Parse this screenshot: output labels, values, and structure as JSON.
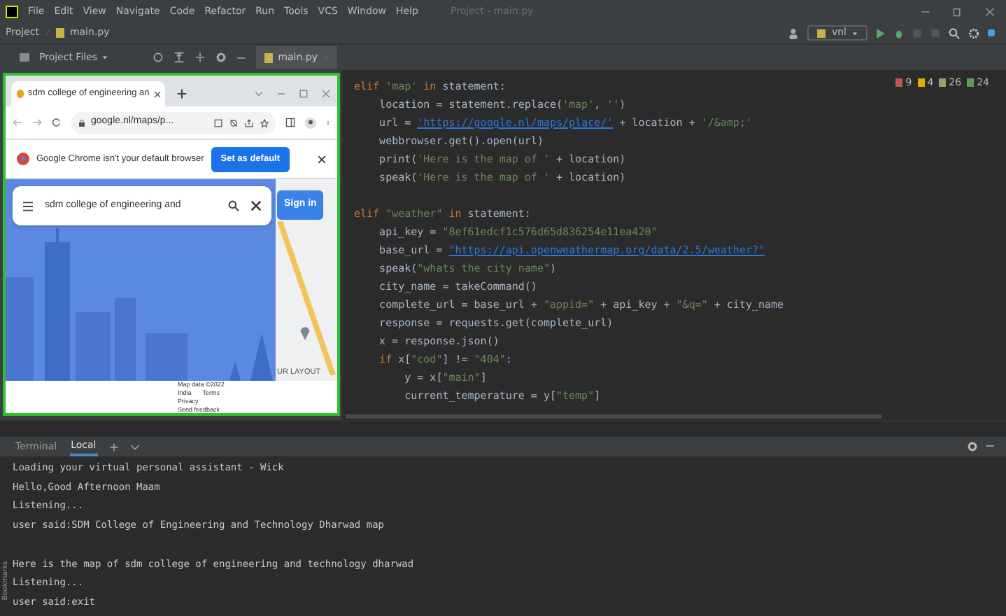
{
  "menu_bar": {
    "items": [
      "File",
      "Edit",
      "View",
      "Navigate",
      "Code",
      "Refactor",
      "Run",
      "Tools",
      "VCS",
      "Window",
      "Help"
    ],
    "title": "Project - main.py"
  },
  "breadcrumb": [
    "Project",
    "main.py"
  ],
  "project_panel": {
    "title": "Project Files"
  },
  "editor_tab": {
    "label": "main.py"
  },
  "run_config": "vnl",
  "inspections": [
    {
      "kind": "error",
      "count": "9"
    },
    {
      "kind": "warning",
      "count": "4"
    },
    {
      "kind": "weak",
      "count": "26"
    },
    {
      "kind": "typo",
      "count": "24"
    }
  ],
  "code_lines": [
    {
      "kind": "code",
      "tokens": [
        {
          "t": "elif ",
          "kind": "kw"
        },
        {
          "t": "'map'",
          "kind": "str"
        },
        {
          "t": " in ",
          "kind": "kw"
        },
        {
          "t": "statement:",
          "kind": "plain"
        }
      ]
    },
    {
      "kind": "code",
      "tokens": [
        {
          "t": "    location = statement.replace(",
          "kind": "plain"
        },
        {
          "t": "'map'",
          "kind": "str"
        },
        {
          "t": ", ",
          "kind": "plain"
        },
        {
          "t": "''",
          "kind": "str"
        },
        {
          "t": ")",
          "kind": "plain"
        }
      ]
    },
    {
      "kind": "code",
      "tokens": [
        {
          "t": "    url = ",
          "kind": "plain"
        },
        {
          "t": "'https://google.nl/maps/place/'",
          "kind": "link"
        },
        {
          "t": " + location + ",
          "kind": "plain"
        },
        {
          "t": "'/&amp;'",
          "kind": "str"
        }
      ]
    },
    {
      "kind": "code",
      "tokens": [
        {
          "t": "    webbrowser.get().open(url)",
          "kind": "plain"
        }
      ]
    },
    {
      "kind": "code",
      "tokens": [
        {
          "t": "    print(",
          "kind": "plain"
        },
        {
          "t": "'Here is the map of '",
          "kind": "str"
        },
        {
          "t": " + location)",
          "kind": "plain"
        }
      ]
    },
    {
      "kind": "code",
      "tokens": [
        {
          "t": "    speak(",
          "kind": "plain"
        },
        {
          "t": "'Here is the map of '",
          "kind": "str"
        },
        {
          "t": " + location)",
          "kind": "plain"
        }
      ]
    },
    {
      "kind": "blank"
    },
    {
      "kind": "code",
      "tokens": [
        {
          "t": "elif ",
          "kind": "kw"
        },
        {
          "t": "\"weather\"",
          "kind": "str"
        },
        {
          "t": " in ",
          "kind": "kw"
        },
        {
          "t": "statement:",
          "kind": "plain"
        }
      ]
    },
    {
      "kind": "code",
      "tokens": [
        {
          "t": "    api_key = ",
          "kind": "plain"
        },
        {
          "t": "\"8ef61edcf1c576d65d836254e11ea420\"",
          "kind": "str"
        }
      ]
    },
    {
      "kind": "code",
      "tokens": [
        {
          "t": "    base_url = ",
          "kind": "plain"
        },
        {
          "t": "\"https://api.openweathermap.org/data/2.5/weather?\"",
          "kind": "link"
        }
      ]
    },
    {
      "kind": "code",
      "tokens": [
        {
          "t": "    speak(",
          "kind": "plain"
        },
        {
          "t": "\"whats the city name\"",
          "kind": "str"
        },
        {
          "t": ")",
          "kind": "plain"
        }
      ]
    },
    {
      "kind": "code",
      "tokens": [
        {
          "t": "    city_name = takeCommand()",
          "kind": "plain"
        }
      ]
    },
    {
      "kind": "code",
      "tokens": [
        {
          "t": "    complete_url = base_url + ",
          "kind": "plain"
        },
        {
          "t": "\"appid=\"",
          "kind": "str"
        },
        {
          "t": " + api_key + ",
          "kind": "plain"
        },
        {
          "t": "\"&q=\"",
          "kind": "str"
        },
        {
          "t": " + city_name",
          "kind": "plain"
        }
      ]
    },
    {
      "kind": "code",
      "tokens": [
        {
          "t": "    response = requests.get(complete_url)",
          "kind": "plain"
        }
      ]
    },
    {
      "kind": "code",
      "tokens": [
        {
          "t": "    x = response.json()",
          "kind": "plain"
        }
      ]
    },
    {
      "kind": "code",
      "tokens": [
        {
          "t": "    if ",
          "kind": "kw"
        },
        {
          "t": "x[",
          "kind": "plain"
        },
        {
          "t": "\"cod\"",
          "kind": "str"
        },
        {
          "t": "] != ",
          "kind": "plain"
        },
        {
          "t": "\"404\"",
          "kind": "str"
        },
        {
          "t": ":",
          "kind": "plain"
        }
      ]
    },
    {
      "kind": "code",
      "tokens": [
        {
          "t": "        y = x[",
          "kind": "plain"
        },
        {
          "t": "\"main\"",
          "kind": "str"
        },
        {
          "t": "]",
          "kind": "plain"
        }
      ]
    },
    {
      "kind": "code",
      "tokens": [
        {
          "t": "        current_temperature = y[",
          "kind": "plain"
        },
        {
          "t": "\"temp\"",
          "kind": "str"
        },
        {
          "t": "]",
          "kind": "plain"
        }
      ]
    }
  ],
  "browser": {
    "tab_title": "sdm college of engineering an",
    "address": "google.nl/maps/p...",
    "infobar": {
      "message": "Google Chrome isn't your default browser",
      "button": "Set as default"
    },
    "search": {
      "value": "sdm college of engineering and"
    },
    "sign_in": "Sign in",
    "map_label": "UR LAYOUT",
    "attribution": "Map data ©2022",
    "footer_links": [
      "India",
      "Terms",
      "Privacy",
      "Send feedback"
    ]
  },
  "terminal": {
    "tabs": [
      {
        "label": "Terminal",
        "selected": false
      },
      {
        "label": "Local",
        "selected": true
      }
    ],
    "lines": [
      {
        "kind": "text",
        "text": "Loading your virtual personal assistant - Wick"
      },
      {
        "kind": "text",
        "text": "Hello,Good Afternoon Maam"
      },
      {
        "kind": "text",
        "text": "Listening..."
      },
      {
        "kind": "text",
        "text": "user said:SDM College of Engineering and Technology Dharwad map"
      },
      {
        "kind": "blank"
      },
      {
        "kind": "text",
        "text": "Here is the map of sdm college of engineering and technology dharwad"
      },
      {
        "kind": "text",
        "text": "Listening..."
      },
      {
        "kind": "text",
        "text": "user said:exit"
      }
    ]
  },
  "side_labels": {
    "bookmarks": "Bookmarks"
  }
}
